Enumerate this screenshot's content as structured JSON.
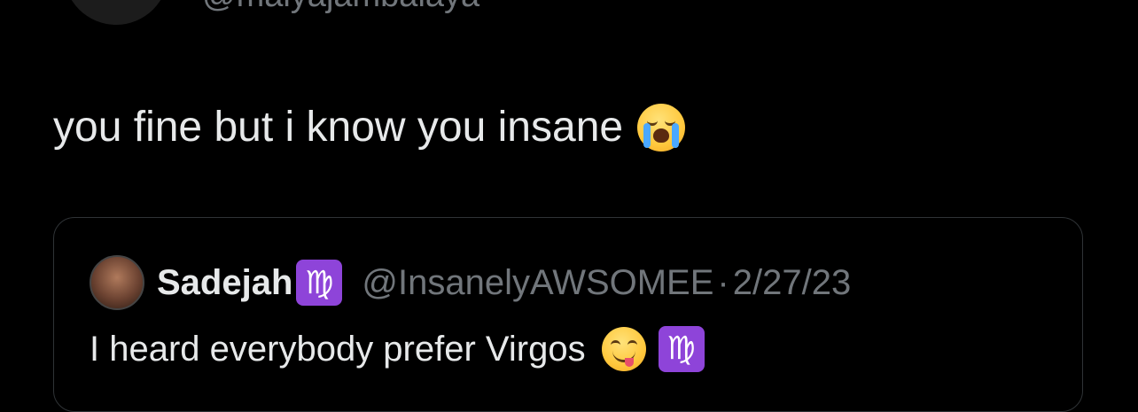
{
  "top_tweet": {
    "handle": "@malyajambalaya",
    "text": "you fine but i know you insane",
    "emoji_icon": "loudly-crying-face-emoji"
  },
  "quote_tweet": {
    "display_name": "Sadejah",
    "name_badge": "♍",
    "handle": "@InsanelyAWSOMEE",
    "separator": "·",
    "date": "2/27/23",
    "text": "I heard everybody prefer Virgos",
    "text_emojis": [
      "face-savoring-food-emoji",
      "virgo-emoji"
    ],
    "text_badge": "♍"
  },
  "colors": {
    "background": "#000000",
    "primary_text": "#e7e9ea",
    "secondary_text": "#71767b",
    "card_border": "#2f3336",
    "virgo_purple": "#8e44d9"
  }
}
